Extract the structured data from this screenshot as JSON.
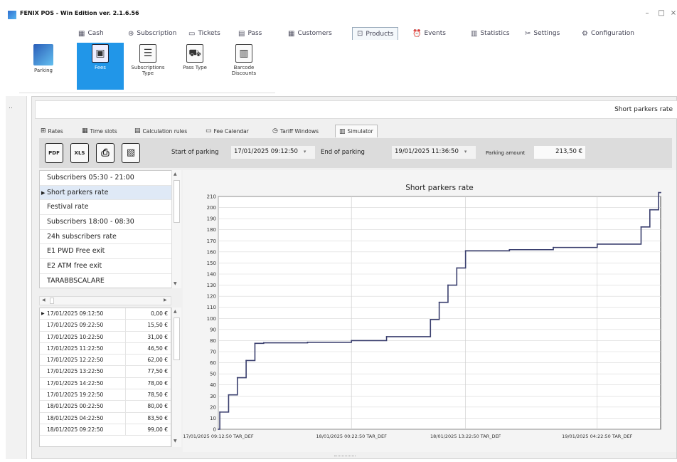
{
  "window": {
    "title": "FENIX POS - Win Edition ver. 2.1.6.56",
    "minimize": "–",
    "maximize": "□",
    "close": "×"
  },
  "menu": [
    {
      "label": "Cash",
      "icon": "cash-register-icon",
      "glyph": "▦"
    },
    {
      "label": "Subscription",
      "icon": "subscription-icon",
      "glyph": "⊛"
    },
    {
      "label": "Tickets",
      "icon": "tickets-icon",
      "glyph": "▭"
    },
    {
      "label": "Pass",
      "icon": "pass-icon",
      "glyph": "▤"
    },
    {
      "label": "Customers",
      "icon": "customers-icon",
      "glyph": "▦"
    },
    {
      "label": "Products",
      "icon": "products-icon",
      "glyph": "⊡",
      "active": true
    },
    {
      "label": "Events",
      "icon": "events-icon",
      "glyph": "⏰"
    },
    {
      "label": "Statistics",
      "icon": "statistics-icon",
      "glyph": "▥"
    },
    {
      "label": "Settings",
      "icon": "settings-icon",
      "glyph": "✂"
    },
    {
      "label": "Configuration",
      "icon": "configuration-icon",
      "glyph": "⚙"
    }
  ],
  "ribbon": {
    "parking_label": "Parking",
    "buttons": [
      {
        "label": "Fees",
        "icon": "fees-icon",
        "glyph": "▣",
        "selected": true
      },
      {
        "label": "Subscriptions Type",
        "icon": "subscriptions-type-icon",
        "glyph": "☰"
      },
      {
        "label": "Pass Type",
        "icon": "pass-type-icon",
        "glyph": "⛟"
      },
      {
        "label": "Barcode Discounts",
        "icon": "barcode-discounts-icon",
        "glyph": "▥"
      }
    ]
  },
  "header": {
    "title": "Short parkers rate"
  },
  "tabs": [
    {
      "label": "Rates",
      "icon": "rates-icon",
      "glyph": "⊞"
    },
    {
      "label": "Time slots",
      "icon": "time-slots-icon",
      "glyph": "▦"
    },
    {
      "label": "Calculation rules",
      "icon": "calculation-rules-icon",
      "glyph": "▤"
    },
    {
      "label": "Fee Calendar",
      "icon": "fee-calendar-icon",
      "glyph": "▭"
    },
    {
      "label": "Tariff Windows",
      "icon": "tariff-windows-icon",
      "glyph": "◷"
    },
    {
      "label": "Simulator",
      "icon": "simulator-icon",
      "glyph": "▥",
      "active": true
    }
  ],
  "toolbar": {
    "pdf_label": "PDF",
    "xls_label": "XLS",
    "print_label": "⎙",
    "export_label": "▧",
    "start_label": "Start of parking",
    "start_value": "17/01/2025 09:12:50",
    "end_label": "End of parking",
    "end_value": "19/01/2025 11:36:50",
    "amount_label": "Parking amount",
    "amount_value": "213,50 €",
    "dropdown_glyph": "▾"
  },
  "rates": [
    {
      "name": "Subscribers 05:30 - 21:00"
    },
    {
      "name": "Short parkers rate",
      "selected": true
    },
    {
      "name": "Festival rate"
    },
    {
      "name": "Subscribers 18:00 - 08:30"
    },
    {
      "name": "24h subscribers rate"
    },
    {
      "name": "E1 PWD Free exit"
    },
    {
      "name": "E2 ATM free exit"
    },
    {
      "name": "TARABBSCALARE"
    }
  ],
  "fees": [
    {
      "time": "17/01/2025 09:12:50",
      "amount": "0,00 €"
    },
    {
      "time": "17/01/2025 09:22:50",
      "amount": "15,50 €"
    },
    {
      "time": "17/01/2025 10:22:50",
      "amount": "31,00 €"
    },
    {
      "time": "17/01/2025 11:22:50",
      "amount": "46,50 €"
    },
    {
      "time": "17/01/2025 12:22:50",
      "amount": "62,00 €"
    },
    {
      "time": "17/01/2025 13:22:50",
      "amount": "77,50 €"
    },
    {
      "time": "17/01/2025 14:22:50",
      "amount": "78,00 €"
    },
    {
      "time": "17/01/2025 19:22:50",
      "amount": "78,50 €"
    },
    {
      "time": "18/01/2025 00:22:50",
      "amount": "80,00 €"
    },
    {
      "time": "18/01/2025 04:22:50",
      "amount": "83,50 €"
    },
    {
      "time": "18/01/2025 09:22:50",
      "amount": "99,00 €"
    }
  ],
  "chart_data": {
    "type": "line",
    "title": "Short parkers rate",
    "xlabel": "",
    "ylabel": "",
    "ylim": [
      0,
      210
    ],
    "yticks": [
      0,
      10,
      20,
      30,
      40,
      50,
      60,
      70,
      80,
      90,
      100,
      110,
      120,
      130,
      140,
      150,
      160,
      170,
      180,
      190,
      200,
      210
    ],
    "xlim": [
      0,
      50.4
    ],
    "xticks": [
      {
        "x": 0,
        "label": "17/01/2025 09:12:50 TAR_DEF"
      },
      {
        "x": 15.17,
        "label": "18/01/2025 00:22:50 TAR_DEF"
      },
      {
        "x": 28.17,
        "label": "18/01/2025 13:22:50 TAR_DEF"
      },
      {
        "x": 43.17,
        "label": "19/01/2025 04:22:50 TAR_DEF"
      }
    ],
    "step": true,
    "grid": true,
    "line_color": "#3a3f6e",
    "points": [
      [
        0,
        0
      ],
      [
        0.17,
        15.5
      ],
      [
        1.17,
        31
      ],
      [
        2.17,
        46.5
      ],
      [
        3.17,
        62
      ],
      [
        4.17,
        77.5
      ],
      [
        5.17,
        78
      ],
      [
        10.17,
        78.5
      ],
      [
        15.17,
        80
      ],
      [
        19.17,
        83.5
      ],
      [
        24.17,
        99
      ],
      [
        25.17,
        114.5
      ],
      [
        26.17,
        130
      ],
      [
        27.17,
        145.5
      ],
      [
        28.17,
        161
      ],
      [
        33.17,
        162
      ],
      [
        38.17,
        164
      ],
      [
        43.17,
        167
      ],
      [
        48.17,
        182.5
      ],
      [
        49.17,
        198
      ],
      [
        50.17,
        213.5
      ],
      [
        50.4,
        213.5
      ]
    ]
  }
}
